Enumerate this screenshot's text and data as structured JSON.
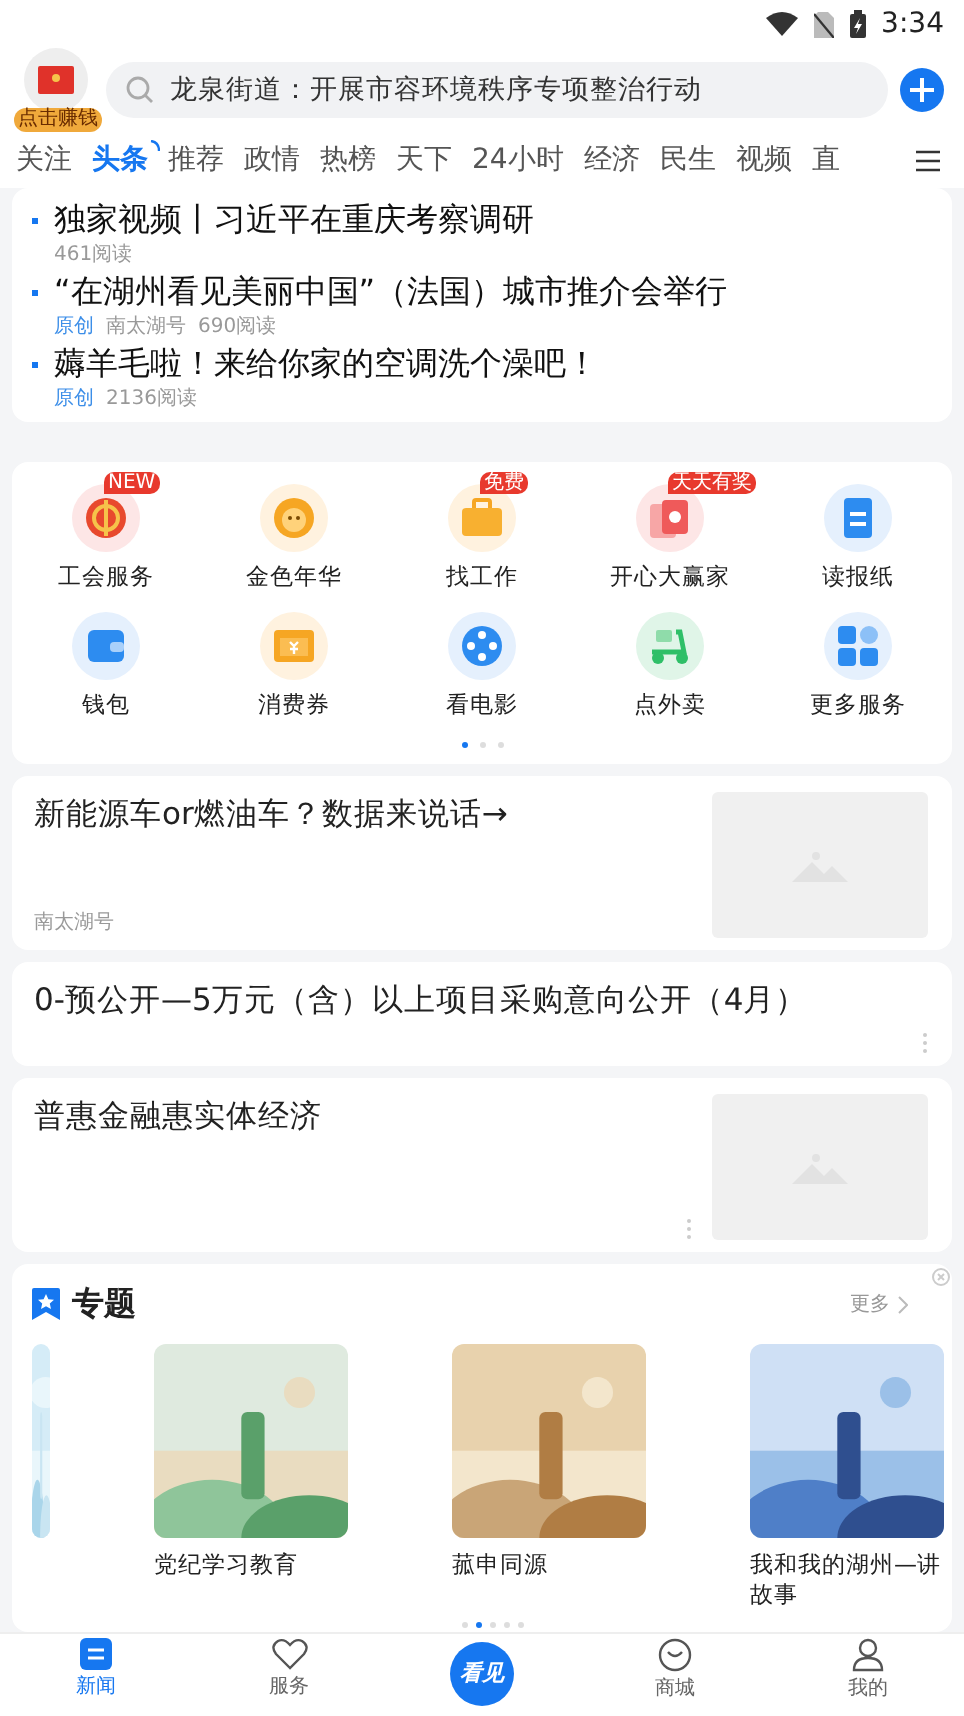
{
  "status_bar": {
    "time": "3:34"
  },
  "header": {
    "avatar_badge": "点击赚钱",
    "search": {
      "placeholder": "龙泉街道：开展市容环境秩序专项整治行动"
    }
  },
  "tabs": [
    {
      "label": "关注",
      "selected": false
    },
    {
      "label": "头条",
      "selected": true
    },
    {
      "label": "推荐",
      "selected": false
    },
    {
      "label": "政情",
      "selected": false
    },
    {
      "label": "热榜",
      "selected": false
    },
    {
      "label": "天下",
      "selected": false
    },
    {
      "label": "24小时",
      "selected": false
    },
    {
      "label": "经济",
      "selected": false
    },
    {
      "label": "民生",
      "selected": false
    },
    {
      "label": "视频",
      "selected": false
    },
    {
      "label": "直",
      "selected": false
    }
  ],
  "headlines": [
    {
      "title": "独家视频丨习近平在重庆考察调研",
      "reads": "461阅读"
    },
    {
      "title": "“在湖州看见美丽中国”（法国）城市推介会举行",
      "tag": "原创",
      "source": "南太湖号",
      "reads": "690阅读"
    },
    {
      "title": "薅羊毛啦！来给你家的空调洗个澡吧！",
      "tag": "原创",
      "reads": "2136阅读"
    }
  ],
  "services": [
    {
      "label": "工会服务",
      "kind": "union",
      "badge": "NEW"
    },
    {
      "label": "金色年华",
      "kind": "lion"
    },
    {
      "label": "找工作",
      "kind": "briefcase",
      "badge": "免费"
    },
    {
      "label": "开心大赢家",
      "kind": "cards",
      "badge": "天天有奖"
    },
    {
      "label": "读报纸",
      "kind": "newspaper"
    },
    {
      "label": "钱包",
      "kind": "wallet"
    },
    {
      "label": "消费券",
      "kind": "coupon"
    },
    {
      "label": "看电影",
      "kind": "film"
    },
    {
      "label": "点外卖",
      "kind": "scooter"
    },
    {
      "label": "更多服务",
      "kind": "grid"
    }
  ],
  "services_pager": [
    {
      "selected": true
    },
    {
      "selected": false
    },
    {
      "selected": false
    }
  ],
  "articles": [
    {
      "kind": "with-image",
      "title": "新能源车or燃油车？数据来说话→",
      "source": "南太湖号",
      "more": false
    },
    {
      "kind": "text-only",
      "title": "0-预公开—5万元（含）以上项目采购意向公开（4月）",
      "more": true
    },
    {
      "kind": "with-image",
      "title": "普惠金融惠实体经济",
      "more": true
    }
  ],
  "topics": {
    "title": "专题",
    "more": "更多",
    "items": [
      {
        "title": "党纪学习教育",
        "kind": "green"
      },
      {
        "title": "菰申同源",
        "kind": "sepia"
      },
      {
        "title": "我和我的湖州—讲故事",
        "kind": "blue"
      }
    ],
    "pager": [
      {
        "selected": false
      },
      {
        "selected": true
      },
      {
        "selected": false
      },
      {
        "selected": false
      },
      {
        "selected": false
      }
    ]
  },
  "bottom_nav": [
    {
      "label": "新闻",
      "kind": "news",
      "selected": true
    },
    {
      "label": "服务",
      "kind": "heart",
      "selected": false
    },
    {
      "label": "看见",
      "kind": "center",
      "selected": false
    },
    {
      "label": "商城",
      "kind": "shop",
      "selected": false
    },
    {
      "label": "我的",
      "kind": "user",
      "selected": false
    }
  ]
}
